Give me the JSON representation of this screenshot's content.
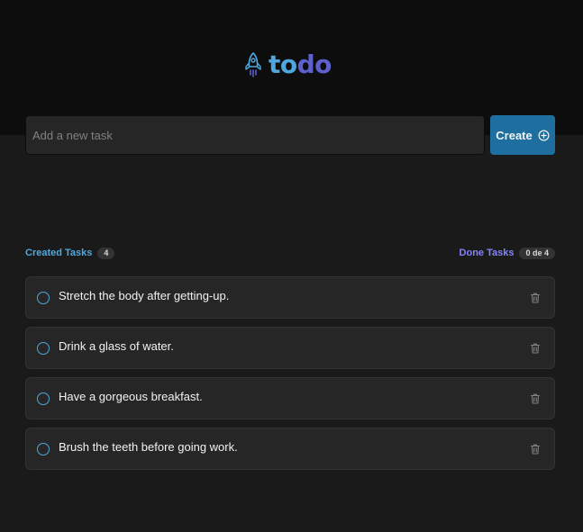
{
  "app": {
    "logo_part1": "to",
    "logo_part2": "do",
    "accent_blue": "#4ea8de",
    "accent_purple": "#5e60ce"
  },
  "new_task": {
    "placeholder": "Add a new task",
    "value": "",
    "create_label": "Create",
    "create_icon": "plus-circle-icon"
  },
  "counters": {
    "created_label": "Created Tasks",
    "created_count": "4",
    "done_label": "Done Tasks",
    "done_count": "0 de 4"
  },
  "tasks": [
    {
      "text": "Stretch the body after getting-up.",
      "done": false
    },
    {
      "text": "Drink a glass of water.",
      "done": false
    },
    {
      "text": "Have a gorgeous breakfast.",
      "done": false
    },
    {
      "text": "Brush the teeth before going work.",
      "done": false
    }
  ]
}
